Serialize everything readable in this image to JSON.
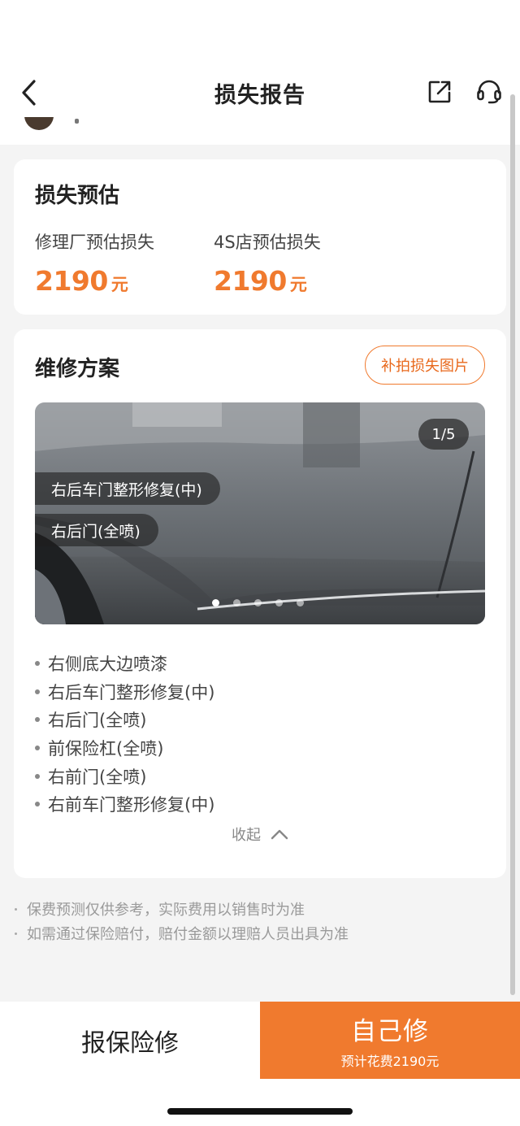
{
  "nav": {
    "title": "损失报告",
    "back_icon": "chevron-left-icon",
    "share_icon": "share-icon",
    "service_icon": "headset-icon"
  },
  "loss": {
    "title": "损失预估",
    "repair_shop": {
      "label": "修理厂预估损失",
      "amount": "2190",
      "unit": "元"
    },
    "dealer_4s": {
      "label": "4S店预估损失",
      "amount": "2190",
      "unit": "元"
    }
  },
  "repair": {
    "title": "维修方案",
    "supplement_button": "补拍损失图片",
    "photo": {
      "counter": "1/5",
      "tags": [
        "右后车门整形修复(中)",
        "右后门(全喷)"
      ],
      "page_count": 5,
      "active_page": 1
    },
    "items": [
      "右侧底大边喷漆",
      "右后车门整形修复(中)",
      "右后门(全喷)",
      "前保险杠(全喷)",
      "右前门(全喷)",
      "右前车门整形修复(中)"
    ],
    "collapse_label": "收起"
  },
  "notes": [
    "保费预测仅供参考，实际费用以销售时为准",
    "如需通过保险赔付，赔付金额以理赔人员出具为准"
  ],
  "footer": {
    "insure_label": "报保险修",
    "self_label": "自己修",
    "self_sub": "预计花费2190元"
  },
  "colors": {
    "accent": "#f07a2e",
    "background": "#f4f4f4",
    "card": "#ffffff"
  }
}
